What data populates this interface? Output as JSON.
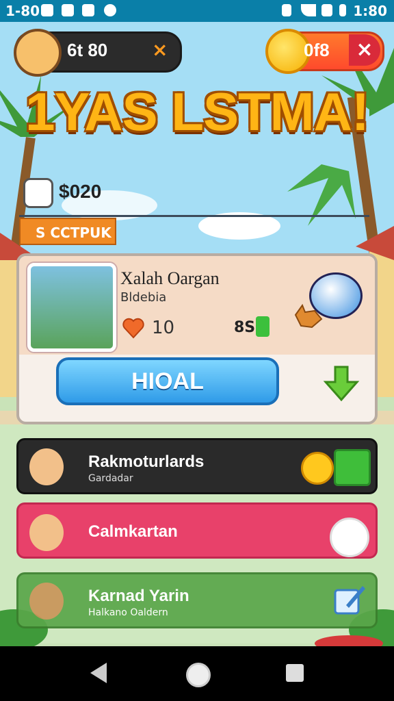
{
  "status_bar": {
    "time_left": "1-80",
    "time_right": "1:80"
  },
  "hud": {
    "left_value": "6t 80",
    "right_value": "0f8",
    "left_close": "×",
    "right_close": "×"
  },
  "title": "1YAS LSTMA!",
  "stats": {
    "value": "$020",
    "tag": "S CCTPUK"
  },
  "card": {
    "title": "Xalah Oargan",
    "subtitle": "Bldebia",
    "likes": "10",
    "price": "8S",
    "button_label": "HIOAL"
  },
  "list": [
    {
      "name": "Rakmoturlards",
      "sub": "Gardadar"
    },
    {
      "name": "Calmkartan",
      "sub": ""
    },
    {
      "name": "Karnad Yarin",
      "sub": "Halkano Oaldern"
    }
  ],
  "colors": {
    "accent": "#2f9be8",
    "title": "#ffb515",
    "row_pink": "#e8416a",
    "row_dark": "#2a2a2a",
    "row_green": "#5aa64a"
  }
}
